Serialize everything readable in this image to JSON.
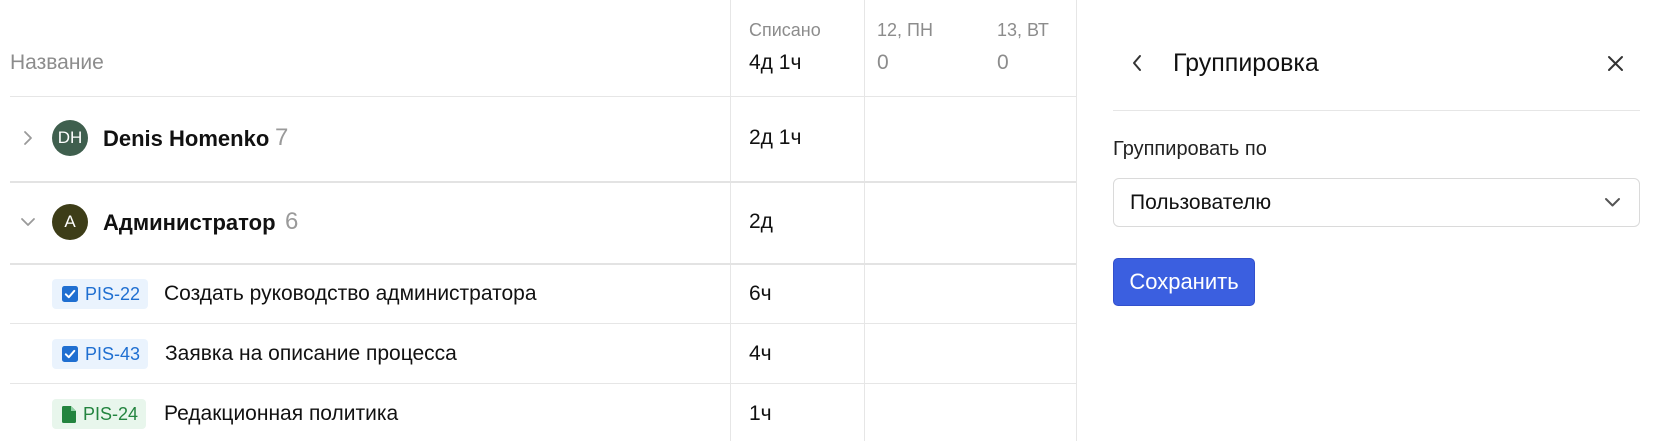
{
  "table": {
    "header": {
      "name_label": "Название",
      "spent_label": "Списано",
      "spent_total": "4д 1ч",
      "days": [
        {
          "label": "12, ПН",
          "value": "0"
        },
        {
          "label": "13, ВТ",
          "value": "0"
        }
      ]
    },
    "groups": [
      {
        "initials": "DH",
        "avatar_color": "#3f5f4e",
        "name": "Denis Homenko",
        "count": "7",
        "spent": "2д 1ч",
        "expanded": false
      },
      {
        "initials": "А",
        "avatar_color": "#3d3d18",
        "name": "Администратор",
        "count": "6",
        "spent": "2д",
        "expanded": true
      }
    ],
    "rows": [
      {
        "key": "PIS-22",
        "type": "task",
        "title": "Создать руководство администратора",
        "spent": "6ч"
      },
      {
        "key": "PIS-43",
        "type": "task",
        "title": "Заявка на описание процесса",
        "spent": "4ч"
      },
      {
        "key": "PIS-24",
        "type": "doc",
        "title": "Редакционная политика",
        "spent": "1ч"
      }
    ]
  },
  "panel": {
    "title": "Группировка",
    "group_by_label": "Группировать по",
    "group_by_value": "Пользователю",
    "save_label": "Сохранить"
  },
  "colors": {
    "task_tag_text": "#1f6fd1",
    "task_tag_bg": "#eaf3fd",
    "doc_tag_text": "#23843f",
    "doc_tag_bg": "#e8f6ec",
    "primary_button": "#3b5fe0"
  },
  "icons": {
    "group_collapsed": "chevron-right-icon",
    "group_expanded": "chevron-down-icon",
    "task": "checkbox-icon",
    "doc": "document-icon",
    "back": "chevron-left-icon",
    "close": "close-icon",
    "dropdown": "chevron-down-icon"
  }
}
